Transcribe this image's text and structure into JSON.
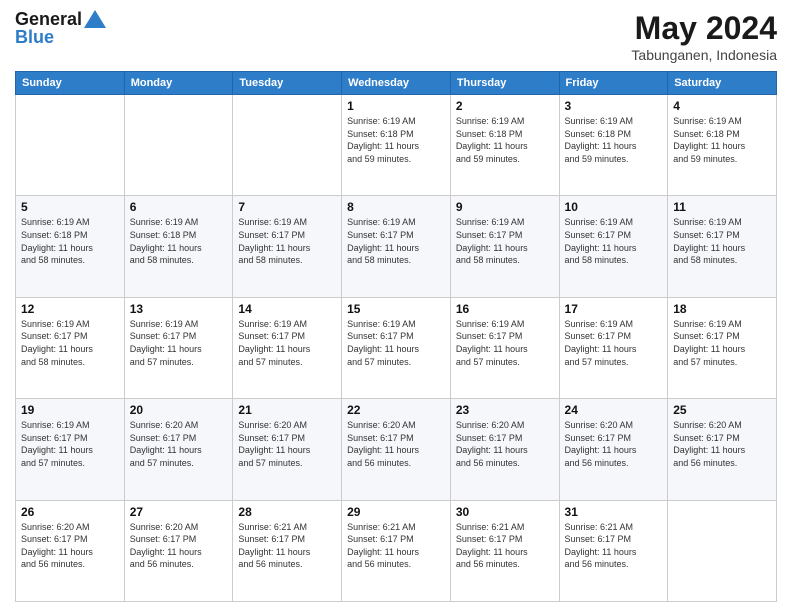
{
  "logo": {
    "text1": "General",
    "text2": "Blue"
  },
  "header": {
    "title": "May 2024",
    "location": "Tabunganen, Indonesia"
  },
  "weekdays": [
    "Sunday",
    "Monday",
    "Tuesday",
    "Wednesday",
    "Thursday",
    "Friday",
    "Saturday"
  ],
  "weeks": [
    [
      {
        "day": "",
        "info": ""
      },
      {
        "day": "",
        "info": ""
      },
      {
        "day": "",
        "info": ""
      },
      {
        "day": "1",
        "info": "Sunrise: 6:19 AM\nSunset: 6:18 PM\nDaylight: 11 hours\nand 59 minutes."
      },
      {
        "day": "2",
        "info": "Sunrise: 6:19 AM\nSunset: 6:18 PM\nDaylight: 11 hours\nand 59 minutes."
      },
      {
        "day": "3",
        "info": "Sunrise: 6:19 AM\nSunset: 6:18 PM\nDaylight: 11 hours\nand 59 minutes."
      },
      {
        "day": "4",
        "info": "Sunrise: 6:19 AM\nSunset: 6:18 PM\nDaylight: 11 hours\nand 59 minutes."
      }
    ],
    [
      {
        "day": "5",
        "info": "Sunrise: 6:19 AM\nSunset: 6:18 PM\nDaylight: 11 hours\nand 58 minutes."
      },
      {
        "day": "6",
        "info": "Sunrise: 6:19 AM\nSunset: 6:18 PM\nDaylight: 11 hours\nand 58 minutes."
      },
      {
        "day": "7",
        "info": "Sunrise: 6:19 AM\nSunset: 6:17 PM\nDaylight: 11 hours\nand 58 minutes."
      },
      {
        "day": "8",
        "info": "Sunrise: 6:19 AM\nSunset: 6:17 PM\nDaylight: 11 hours\nand 58 minutes."
      },
      {
        "day": "9",
        "info": "Sunrise: 6:19 AM\nSunset: 6:17 PM\nDaylight: 11 hours\nand 58 minutes."
      },
      {
        "day": "10",
        "info": "Sunrise: 6:19 AM\nSunset: 6:17 PM\nDaylight: 11 hours\nand 58 minutes."
      },
      {
        "day": "11",
        "info": "Sunrise: 6:19 AM\nSunset: 6:17 PM\nDaylight: 11 hours\nand 58 minutes."
      }
    ],
    [
      {
        "day": "12",
        "info": "Sunrise: 6:19 AM\nSunset: 6:17 PM\nDaylight: 11 hours\nand 58 minutes."
      },
      {
        "day": "13",
        "info": "Sunrise: 6:19 AM\nSunset: 6:17 PM\nDaylight: 11 hours\nand 57 minutes."
      },
      {
        "day": "14",
        "info": "Sunrise: 6:19 AM\nSunset: 6:17 PM\nDaylight: 11 hours\nand 57 minutes."
      },
      {
        "day": "15",
        "info": "Sunrise: 6:19 AM\nSunset: 6:17 PM\nDaylight: 11 hours\nand 57 minutes."
      },
      {
        "day": "16",
        "info": "Sunrise: 6:19 AM\nSunset: 6:17 PM\nDaylight: 11 hours\nand 57 minutes."
      },
      {
        "day": "17",
        "info": "Sunrise: 6:19 AM\nSunset: 6:17 PM\nDaylight: 11 hours\nand 57 minutes."
      },
      {
        "day": "18",
        "info": "Sunrise: 6:19 AM\nSunset: 6:17 PM\nDaylight: 11 hours\nand 57 minutes."
      }
    ],
    [
      {
        "day": "19",
        "info": "Sunrise: 6:19 AM\nSunset: 6:17 PM\nDaylight: 11 hours\nand 57 minutes."
      },
      {
        "day": "20",
        "info": "Sunrise: 6:20 AM\nSunset: 6:17 PM\nDaylight: 11 hours\nand 57 minutes."
      },
      {
        "day": "21",
        "info": "Sunrise: 6:20 AM\nSunset: 6:17 PM\nDaylight: 11 hours\nand 57 minutes."
      },
      {
        "day": "22",
        "info": "Sunrise: 6:20 AM\nSunset: 6:17 PM\nDaylight: 11 hours\nand 56 minutes."
      },
      {
        "day": "23",
        "info": "Sunrise: 6:20 AM\nSunset: 6:17 PM\nDaylight: 11 hours\nand 56 minutes."
      },
      {
        "day": "24",
        "info": "Sunrise: 6:20 AM\nSunset: 6:17 PM\nDaylight: 11 hours\nand 56 minutes."
      },
      {
        "day": "25",
        "info": "Sunrise: 6:20 AM\nSunset: 6:17 PM\nDaylight: 11 hours\nand 56 minutes."
      }
    ],
    [
      {
        "day": "26",
        "info": "Sunrise: 6:20 AM\nSunset: 6:17 PM\nDaylight: 11 hours\nand 56 minutes."
      },
      {
        "day": "27",
        "info": "Sunrise: 6:20 AM\nSunset: 6:17 PM\nDaylight: 11 hours\nand 56 minutes."
      },
      {
        "day": "28",
        "info": "Sunrise: 6:21 AM\nSunset: 6:17 PM\nDaylight: 11 hours\nand 56 minutes."
      },
      {
        "day": "29",
        "info": "Sunrise: 6:21 AM\nSunset: 6:17 PM\nDaylight: 11 hours\nand 56 minutes."
      },
      {
        "day": "30",
        "info": "Sunrise: 6:21 AM\nSunset: 6:17 PM\nDaylight: 11 hours\nand 56 minutes."
      },
      {
        "day": "31",
        "info": "Sunrise: 6:21 AM\nSunset: 6:17 PM\nDaylight: 11 hours\nand 56 minutes."
      },
      {
        "day": "",
        "info": ""
      }
    ]
  ]
}
